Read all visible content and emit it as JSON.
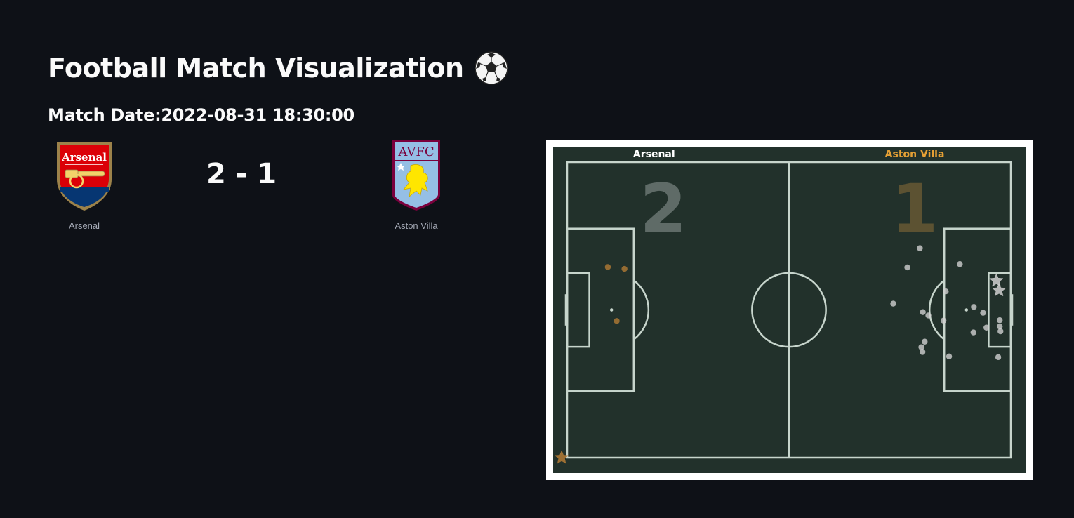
{
  "app": {
    "title": "Football Match Visualization",
    "title_icon": "soccer-ball-icon",
    "match_date_label": "Match Date:",
    "match_date_value": "2022-08-31 18:30:00"
  },
  "match": {
    "home_team": "Arsenal",
    "away_team": "Aston Villa",
    "home_score": 2,
    "away_score": 1,
    "score_text": "2 - 1",
    "home_crest_icon": "arsenal-crest-icon",
    "away_crest_icon": "aston-villa-crest-icon",
    "away_crest_text": "AVFC",
    "home_crest_text": "Arsenal"
  },
  "pitch": {
    "home_label": "Arsenal",
    "away_label": "Aston Villa",
    "home_big_score": "2",
    "away_big_score": "1",
    "colors": {
      "background": "#22312b",
      "lines": "#c7d5cc",
      "home": "#ffffff",
      "away": "#e5a035",
      "home_score_text": "#5f6b67",
      "away_score_text": "#5c5232"
    }
  },
  "chart_data": {
    "type": "scatter",
    "pitch_length": 120,
    "pitch_width": 80,
    "series": [
      {
        "name": "Arsenal",
        "color": "#cfcfcf",
        "shots": [
          {
            "x": 95.4,
            "y": 23.3,
            "goal": false
          },
          {
            "x": 92.0,
            "y": 28.5,
            "goal": false
          },
          {
            "x": 106.2,
            "y": 27.6,
            "goal": false
          },
          {
            "x": 88.2,
            "y": 38.3,
            "goal": false
          },
          {
            "x": 102.4,
            "y": 35.0,
            "goal": false
          },
          {
            "x": 96.2,
            "y": 40.6,
            "goal": false
          },
          {
            "x": 97.7,
            "y": 41.5,
            "goal": false
          },
          {
            "x": 101.8,
            "y": 42.9,
            "goal": false
          },
          {
            "x": 110.0,
            "y": 39.2,
            "goal": false
          },
          {
            "x": 112.5,
            "y": 40.8,
            "goal": false
          },
          {
            "x": 113.4,
            "y": 44.8,
            "goal": false
          },
          {
            "x": 109.9,
            "y": 46.1,
            "goal": false
          },
          {
            "x": 117.0,
            "y": 42.8,
            "goal": false
          },
          {
            "x": 117.0,
            "y": 44.5,
            "goal": false
          },
          {
            "x": 117.2,
            "y": 45.8,
            "goal": false
          },
          {
            "x": 96.7,
            "y": 48.6,
            "goal": false
          },
          {
            "x": 95.8,
            "y": 50.1,
            "goal": false
          },
          {
            "x": 96.1,
            "y": 51.4,
            "goal": false
          },
          {
            "x": 103.3,
            "y": 52.6,
            "goal": false
          },
          {
            "x": 116.6,
            "y": 52.8,
            "goal": false
          },
          {
            "x": 116.1,
            "y": 32.1,
            "goal": true
          },
          {
            "x": 116.8,
            "y": 34.7,
            "goal": true
          }
        ]
      },
      {
        "name": "Aston Villa",
        "color": "#b27a35",
        "shots": [
          {
            "x": 11.0,
            "y": 28.4,
            "goal": false
          },
          {
            "x": 15.5,
            "y": 28.9,
            "goal": false
          },
          {
            "x": 13.4,
            "y": 43.0,
            "goal": false
          },
          {
            "x": -1.5,
            "y": 80.0,
            "goal": true
          }
        ]
      }
    ]
  }
}
